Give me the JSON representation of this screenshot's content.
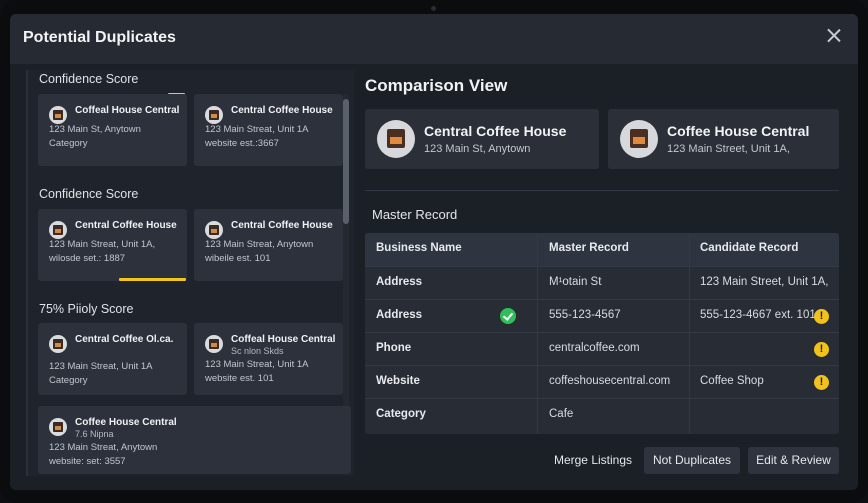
{
  "dialog": {
    "title": "Potential Duplicates",
    "close_icon": "close-icon"
  },
  "left_pane": {
    "groups": [
      {
        "label": "Confidence Score",
        "cards": [
          {
            "name": "Coffeal House Central",
            "line1": "123 Main St, Anytown",
            "line2": "Category"
          },
          {
            "name": "Central Coffee House",
            "line1": "123 Main Streat, Unit 1A",
            "line2": "website est.:3667"
          }
        ]
      },
      {
        "label": "Confidence Score",
        "cards": [
          {
            "name": "Central Coffee House",
            "line1": "123 Main Streat, Unit 1A,",
            "line2": "wilosde set.: 1887"
          },
          {
            "name": "Central Coffee House",
            "line1": "123 Main Streat, Anytown",
            "line2": "wibeile est. 101"
          }
        ]
      },
      {
        "label": "75% Piioly Score",
        "cards": [
          {
            "name": "Central Coffee Ol.ca.",
            "line1": "123 Main Streat, Unit 1A",
            "line2": "Category"
          },
          {
            "name": "Coffeal House Central",
            "sub": "Sc nlon Skds",
            "line1": "123 Main Streat, Unit 1A",
            "line2": "website est. 101"
          },
          {
            "name": "Coffee House Central",
            "sub": "7.6 Nipna",
            "line1": "123 Main Streat, Anytown",
            "line2": "website: set: 3557"
          }
        ]
      }
    ]
  },
  "comparison": {
    "title": "Comparison View",
    "left": {
      "name": "Central Coffee House",
      "address": "123 Main St, Anytown"
    },
    "right": {
      "name": "Coffee House Central",
      "address": "123 Main Street, Unit 1A,"
    },
    "master_title": "Master Record",
    "table": {
      "headers": [
        "Business Name",
        "Master Record",
        "Candidate Record"
      ],
      "rows": [
        {
          "field": "Address",
          "master": "M¹otain St",
          "candidate": "123 Main Street, Unit 1A,"
        },
        {
          "field": "Address",
          "master": "555-123-4567",
          "candidate": "555-123-4667 ext. 101"
        },
        {
          "field": "Phone",
          "master": "centralcoffee.com",
          "candidate": ""
        },
        {
          "field": "Website",
          "master": "coffeshousecentral.com",
          "candidate": "Coffee Shop"
        },
        {
          "field": "Category",
          "master": "Cafe",
          "candidate": ""
        }
      ]
    },
    "status_icons": {
      "match": "check-circle-icon",
      "conflict": "warning-icon",
      "warning_glyph": "!"
    }
  },
  "actions": {
    "merge": "Merge Listings",
    "not_duplicates": "Not Duplicates",
    "edit_review": "Edit & Review"
  },
  "colors": {
    "accent_yellow": "#f4c51a",
    "match_green": "#2fbf5a",
    "background": "#1b1f26"
  }
}
